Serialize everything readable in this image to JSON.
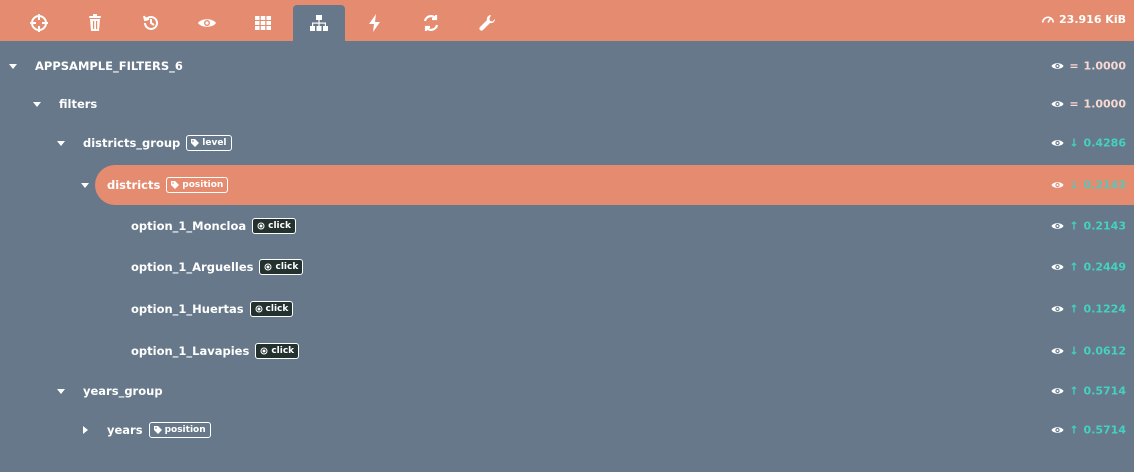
{
  "toolbar": {
    "buttons": [
      {
        "icon": "crosshair-icon"
      },
      {
        "icon": "trash-icon"
      },
      {
        "icon": "history-icon"
      },
      {
        "icon": "eye-icon"
      },
      {
        "icon": "grid-icon"
      },
      {
        "icon": "sitemap-icon",
        "active": true
      },
      {
        "icon": "bolt-icon"
      },
      {
        "icon": "refresh-icon"
      },
      {
        "icon": "wrench-icon"
      }
    ],
    "memory": "23.916 KiB"
  },
  "colors": {
    "accent": "#e58b6f",
    "background": "#66788a",
    "metric_teal": "#44d1c0",
    "metric_pink": "#f8d8d2"
  },
  "tree": [
    {
      "label": "APPSAMPLE_FILTERS_6",
      "tag": "",
      "tag_icon": "",
      "caret": "down",
      "symbol": "=",
      "value": "1.0000"
    },
    {
      "label": "filters",
      "tag": "",
      "tag_icon": "",
      "caret": "down",
      "symbol": "=",
      "value": "1.0000"
    },
    {
      "label": "districts_group",
      "tag": "level",
      "tag_icon": "tag-icon",
      "caret": "down",
      "symbol": "↓",
      "value": "0.4286"
    },
    {
      "label": "districts",
      "tag": "position",
      "tag_icon": "tag-icon",
      "caret": "down",
      "symbol": "↓",
      "value": "0.2143",
      "highlight": true
    },
    {
      "label": "option_1_Moncloa",
      "tag": "click",
      "tag_icon": "target-icon",
      "caret": "",
      "symbol": "↑",
      "value": "0.2143"
    },
    {
      "label": "option_1_Arguelles",
      "tag": "click",
      "tag_icon": "target-icon",
      "caret": "",
      "symbol": "↑",
      "value": "0.2449"
    },
    {
      "label": "option_1_Huertas",
      "tag": "click",
      "tag_icon": "target-icon",
      "caret": "",
      "symbol": "↑",
      "value": "0.1224"
    },
    {
      "label": "option_1_Lavapies",
      "tag": "click",
      "tag_icon": "target-icon",
      "caret": "",
      "symbol": "↓",
      "value": "0.0612"
    },
    {
      "label": "years_group",
      "tag": "",
      "tag_icon": "",
      "caret": "down",
      "symbol": "↑",
      "value": "0.5714"
    },
    {
      "label": "years",
      "tag": "position",
      "tag_icon": "tag-icon",
      "caret": "right",
      "symbol": "↑",
      "value": "0.5714"
    }
  ]
}
